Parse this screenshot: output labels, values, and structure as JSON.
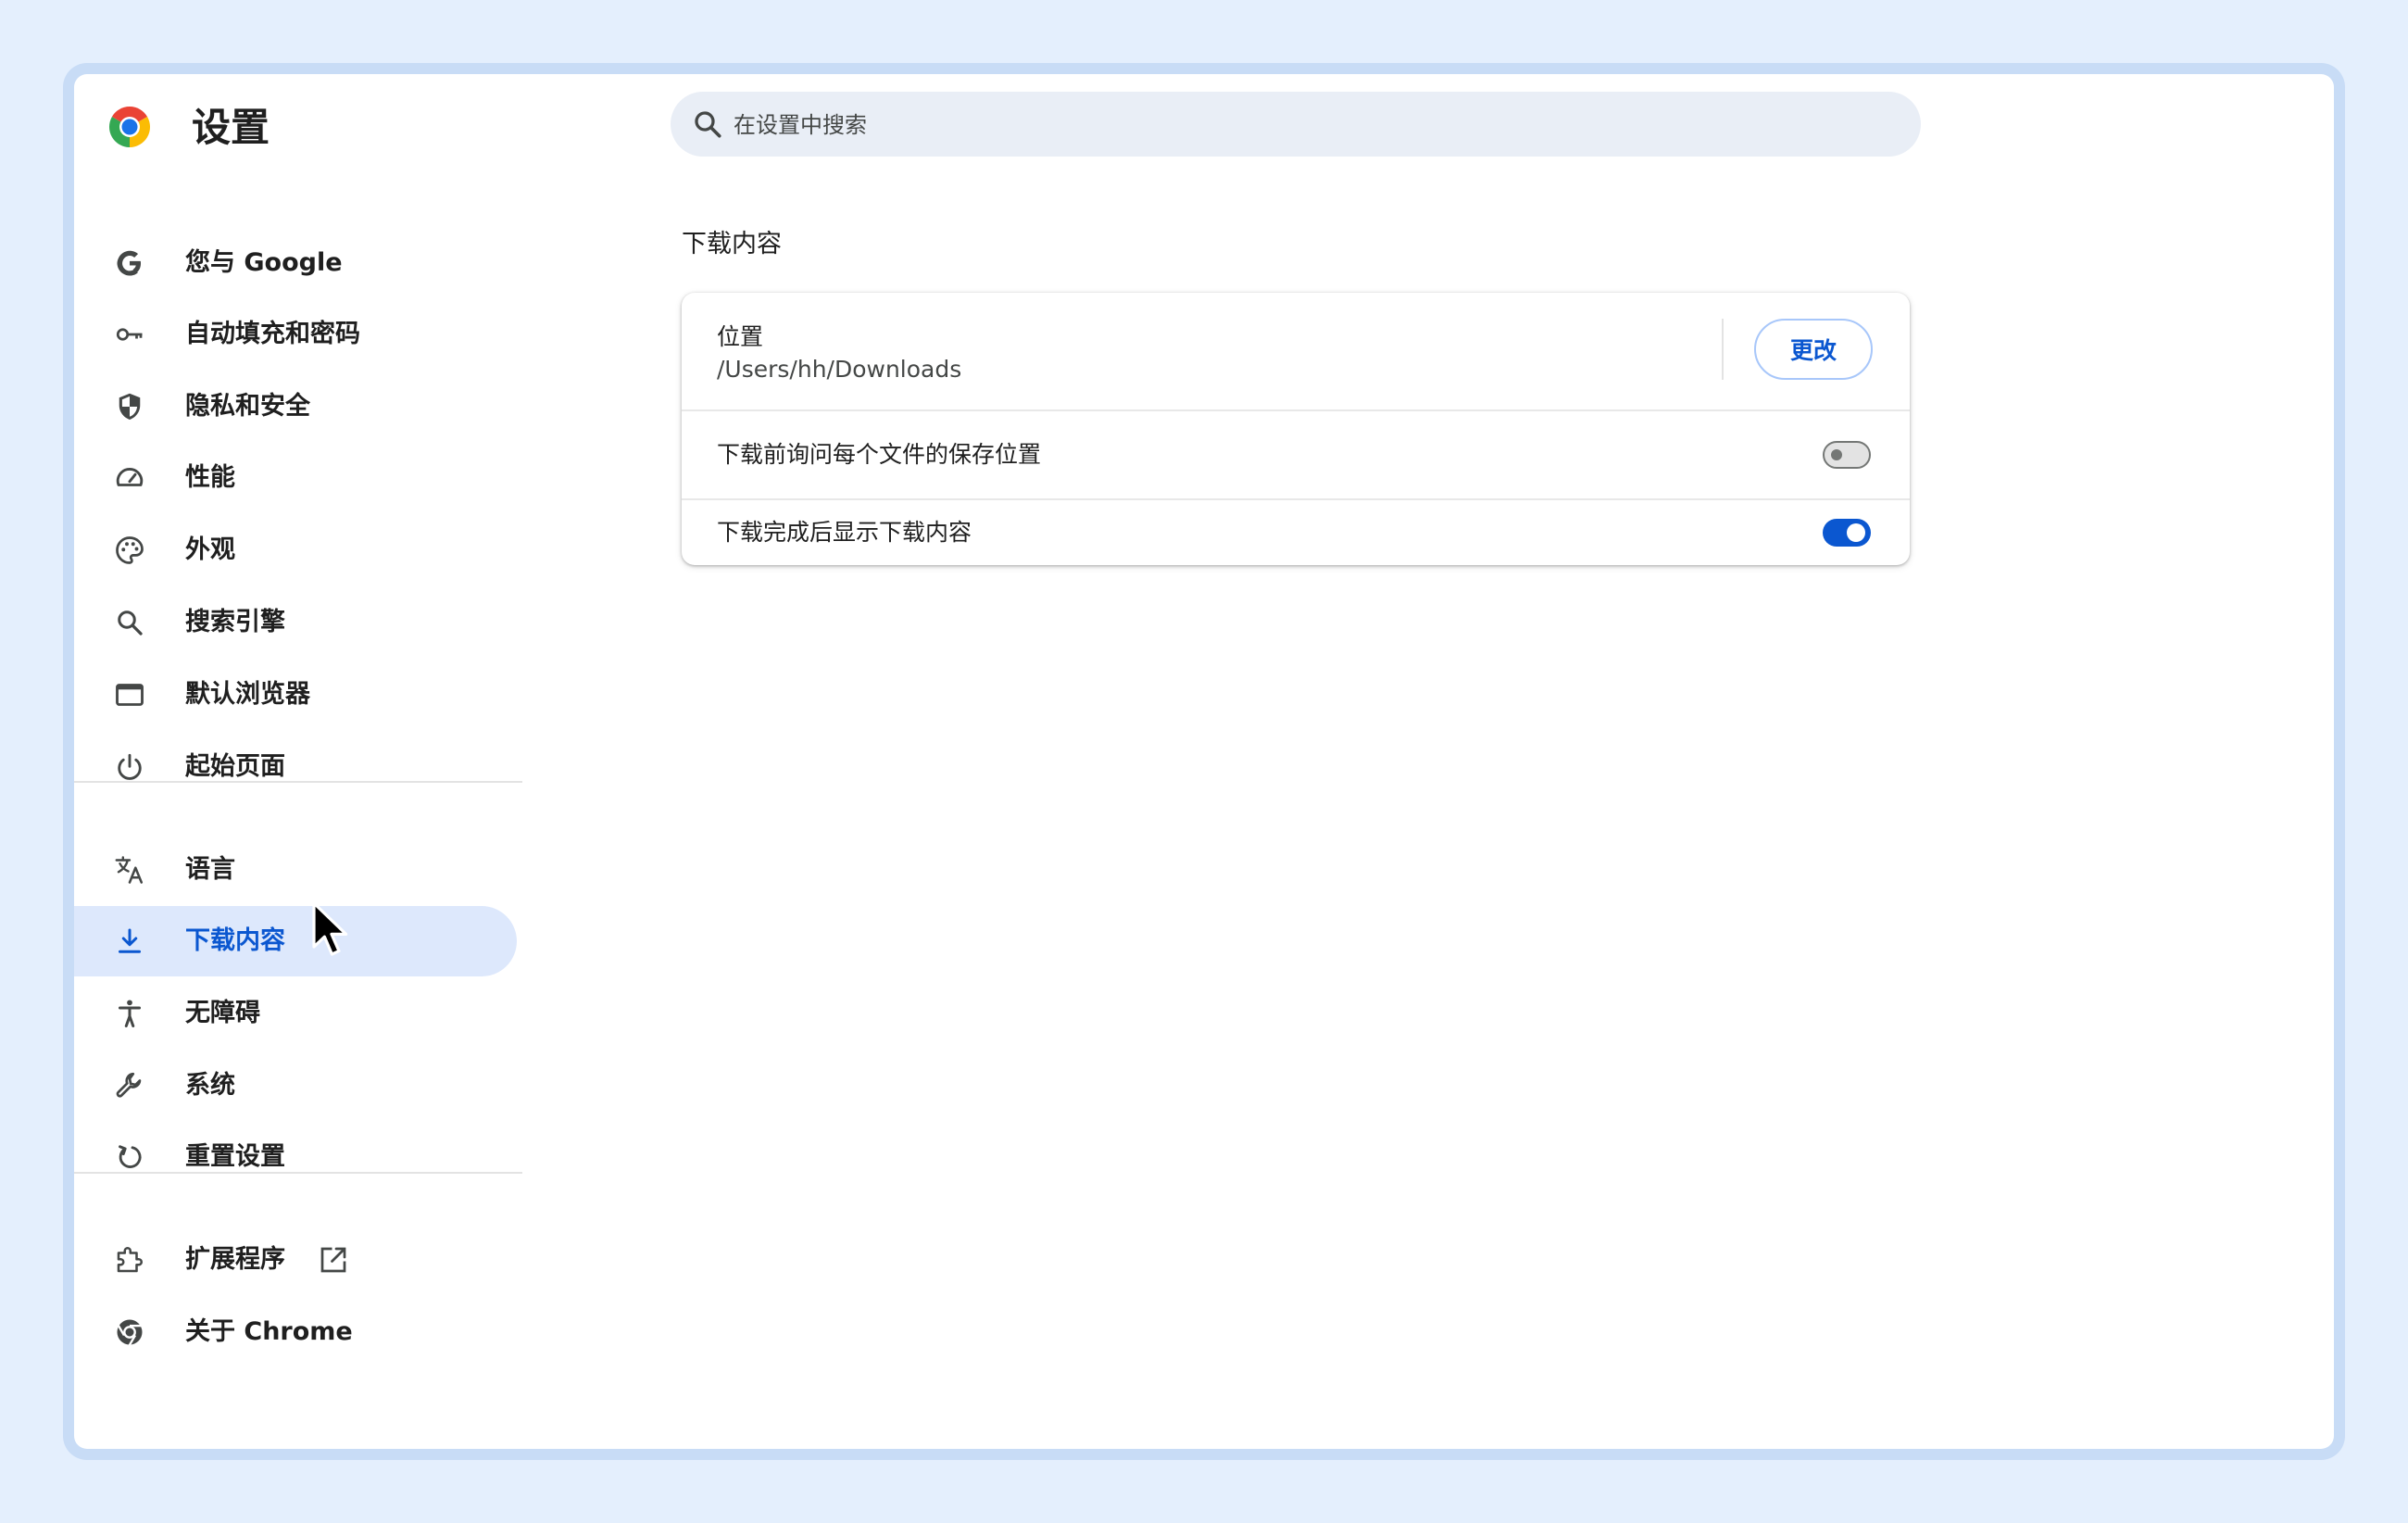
{
  "app": {
    "title": "设置"
  },
  "search": {
    "placeholder": "在设置中搜索"
  },
  "sidebar": {
    "items": [
      {
        "label": "您与 Google",
        "icon": "google-g-icon"
      },
      {
        "label": "自动填充和密码",
        "icon": "key-icon"
      },
      {
        "label": "隐私和安全",
        "icon": "shield-icon"
      },
      {
        "label": "性能",
        "icon": "speedometer-icon"
      },
      {
        "label": "外观",
        "icon": "palette-icon"
      },
      {
        "label": "搜索引擎",
        "icon": "search-icon"
      },
      {
        "label": "默认浏览器",
        "icon": "browser-window-icon"
      },
      {
        "label": "起始页面",
        "icon": "power-icon"
      },
      {
        "label": "语言",
        "icon": "translate-icon"
      },
      {
        "label": "下载内容",
        "icon": "download-icon",
        "active": true
      },
      {
        "label": "无障碍",
        "icon": "accessibility-icon"
      },
      {
        "label": "系统",
        "icon": "wrench-icon"
      },
      {
        "label": "重置设置",
        "icon": "reset-icon"
      },
      {
        "label": "扩展程序",
        "icon": "extension-icon"
      },
      {
        "label": "关于 Chrome",
        "icon": "chrome-icon"
      }
    ]
  },
  "main": {
    "section_title": "下载内容",
    "location": {
      "label": "位置",
      "path": "/Users/hh/Downloads",
      "change_button": "更改"
    },
    "ask_where_to_save": {
      "label": "下载前询问每个文件的保存位置",
      "enabled": false
    },
    "show_downloads_when_done": {
      "label": "下载完成后显示下载内容",
      "enabled": true
    }
  },
  "colors": {
    "accent": "#0b57d0",
    "active_nav_bg": "#dde8fc",
    "page_bg": "#e4effd",
    "search_bg": "#e9eef6"
  }
}
